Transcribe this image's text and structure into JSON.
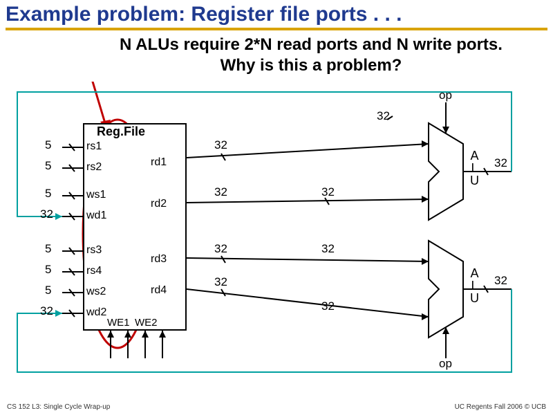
{
  "title": "Example problem: Register file ports . . .",
  "subtitle_line1": "N ALUs require 2*N read ports and N write ports.",
  "subtitle_line2": "Why is this a problem?",
  "regfile": {
    "title": "Reg.File"
  },
  "ports_in": {
    "rs1": "rs1",
    "rs2": "rs2",
    "ws1": "ws1",
    "wd1": "wd1",
    "rs3": "rs3",
    "rs4": "rs4",
    "ws2": "ws2",
    "wd2": "wd2"
  },
  "ports_out": {
    "rd1": "rd1",
    "rd2": "rd2",
    "rd3": "rd3",
    "rd4": "rd4"
  },
  "we": {
    "we1": "WE1",
    "we2": "WE2"
  },
  "bus": {
    "five": "5",
    "thirtytwo": "32"
  },
  "alu": {
    "label": "A\nL\nU",
    "op": "op"
  },
  "footer": {
    "left": "CS 152 L3: Single Cycle Wrap-up",
    "right": "UC Regents Fall 2006 © UCB"
  }
}
